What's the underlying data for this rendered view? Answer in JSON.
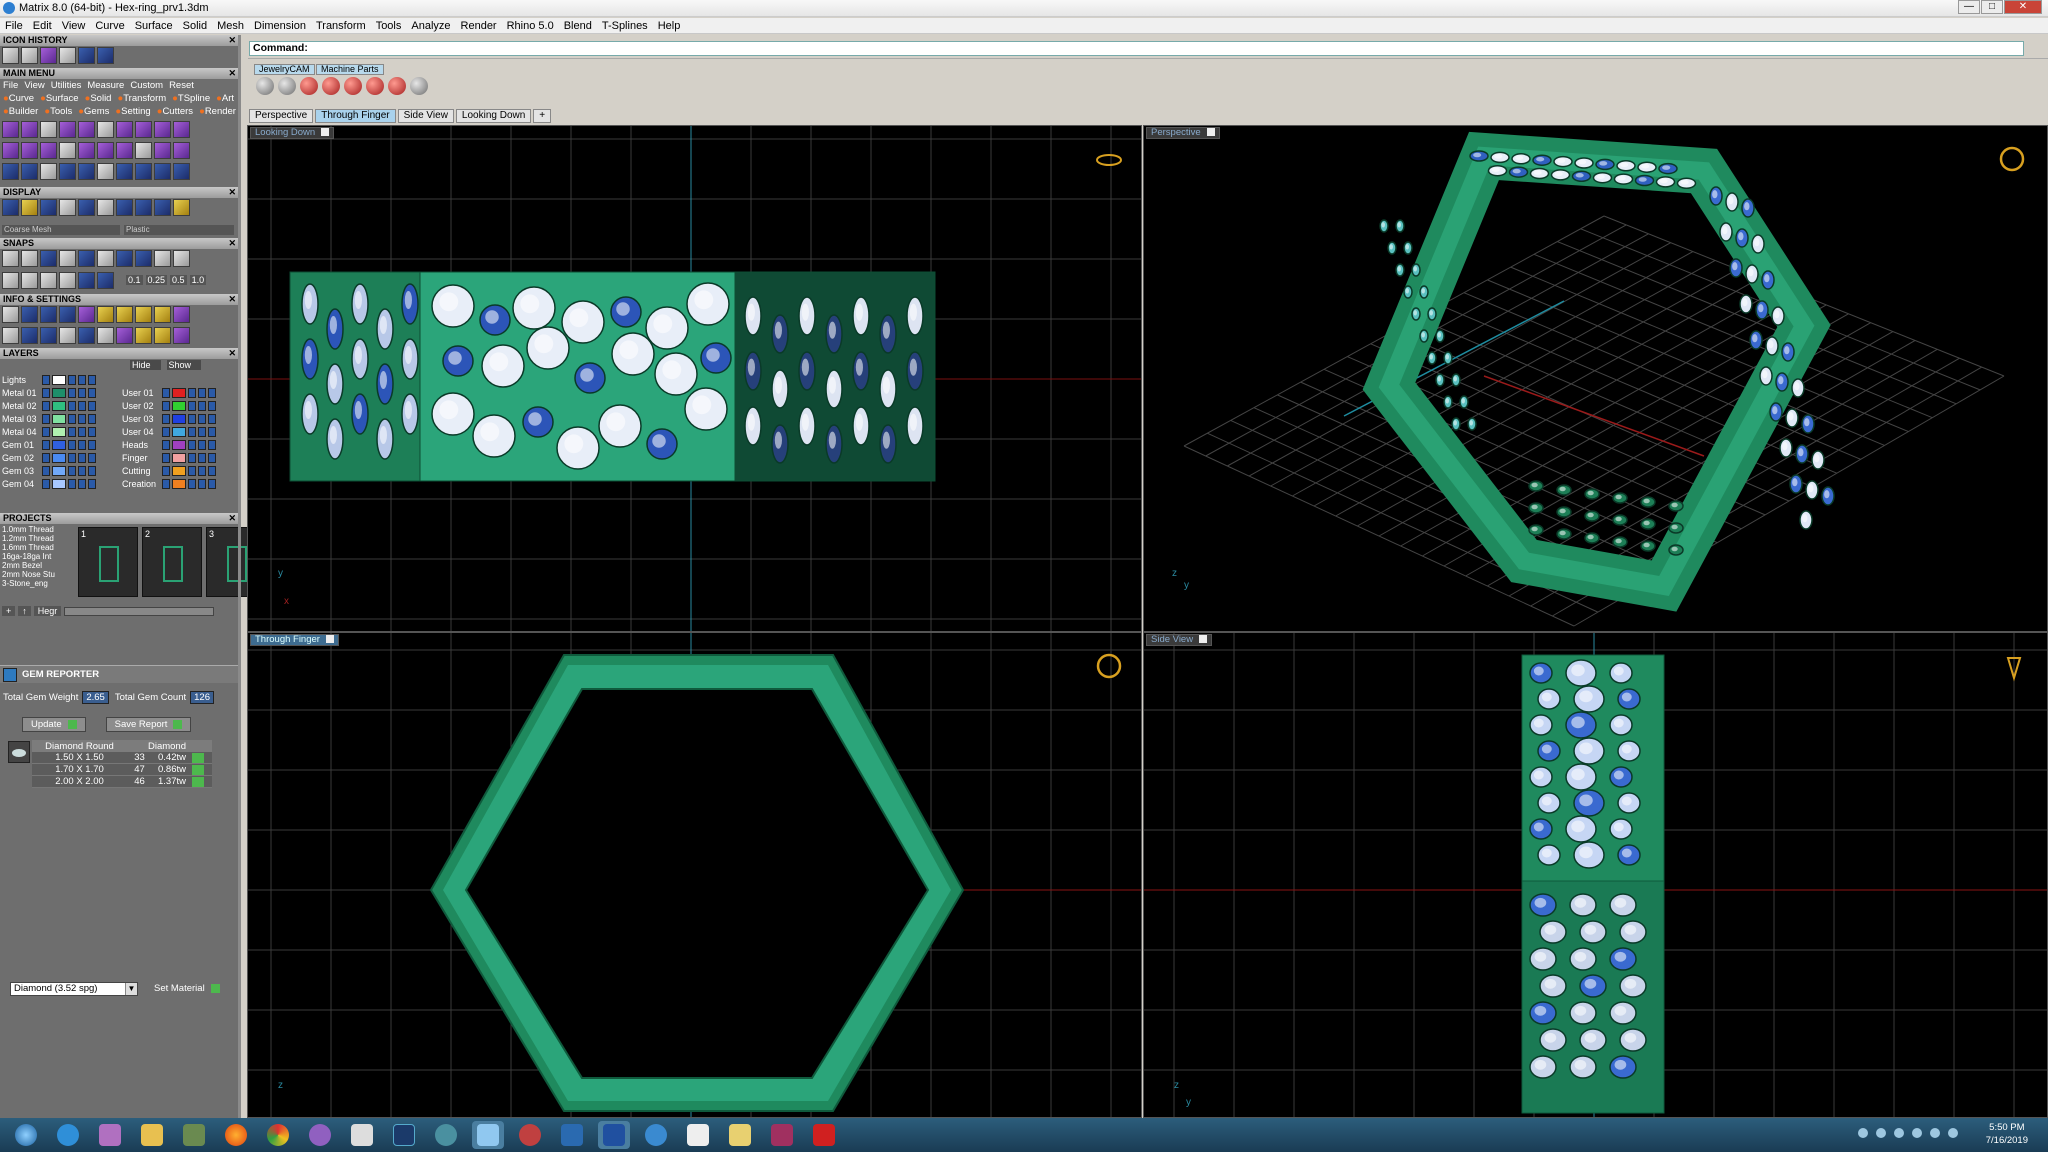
{
  "window": {
    "title": "Matrix 8.0 (64-bit) - Hex-ring_prv1.3dm",
    "min": "—",
    "max": "□",
    "close": "✕"
  },
  "menubar": [
    "File",
    "Edit",
    "View",
    "Curve",
    "Surface",
    "Solid",
    "Mesh",
    "Dimension",
    "Transform",
    "Tools",
    "Analyze",
    "Render",
    "Rhino 5.0",
    "Blend",
    "T-Splines",
    "Help"
  ],
  "left": {
    "icon_history": "ICON HISTORY",
    "main_menu": "MAIN MENU",
    "mm_top": [
      "File",
      "View",
      "Utilities",
      "Measure",
      "Custom",
      "Reset"
    ],
    "mm_row1": [
      "Curve",
      "Surface",
      "Solid",
      "Transform",
      "TSpline",
      "Art"
    ],
    "mm_row2": [
      "Builder",
      "Tools",
      "Gems",
      "Setting",
      "Cutters",
      "Render"
    ],
    "display": "DISPLAY",
    "display_mesh": "Coarse Mesh",
    "display_mat": "Plastic",
    "snaps": "SNAPS",
    "snap_vals": [
      "0.1",
      "0.25",
      "0.5",
      "1.0"
    ],
    "info": "INFO & SETTINGS",
    "layers": "LAYERS",
    "layer_hide": "Hide",
    "layer_show": "Show",
    "layers_left": [
      {
        "name": "Lights",
        "color": "#ffffff"
      },
      {
        "name": "Metal 01",
        "color": "#1e8f6a"
      },
      {
        "name": "Metal 02",
        "color": "#2fbf80"
      },
      {
        "name": "Metal 03",
        "color": "#7fe0a0"
      },
      {
        "name": "Metal 04",
        "color": "#b0f0b0"
      },
      {
        "name": "Gem 01",
        "color": "#3060e0"
      },
      {
        "name": "Gem 02",
        "color": "#4a8af0"
      },
      {
        "name": "Gem 03",
        "color": "#70a8f8"
      },
      {
        "name": "Gem 04",
        "color": "#a8c8ff"
      }
    ],
    "layers_right": [
      {
        "name": "User 01",
        "color": "#e02020"
      },
      {
        "name": "User 02",
        "color": "#30d030"
      },
      {
        "name": "User 03",
        "color": "#2040e0"
      },
      {
        "name": "User 04",
        "color": "#40a8e0"
      },
      {
        "name": "Heads",
        "color": "#a040c0"
      },
      {
        "name": "Finger",
        "color": "#f0a0a0"
      },
      {
        "name": "Cutting",
        "color": "#f0a020"
      },
      {
        "name": "Creation",
        "color": "#f08020"
      }
    ],
    "projects": "PROJECTS",
    "project_items": [
      "1.0mm Thread",
      "1.2mm Thread",
      "1.6mm Thread",
      "16ga-18ga Int",
      "2mm Bezel",
      "2mm Nose Stu",
      "3-Stone_eng"
    ],
    "project_nums": [
      "1",
      "2",
      "3"
    ],
    "project_btn": "Hegr"
  },
  "gem": {
    "title": "GEM REPORTER",
    "tgw_label": "Total Gem Weight",
    "tgw": "2.65",
    "tgc_label": "Total Gem Count",
    "tgc": "126",
    "update": "Update",
    "save": "Save Report",
    "col1": "Diamond Round",
    "col2": "Diamond",
    "rows": [
      {
        "size": "1.50 X 1.50",
        "count": "33",
        "wt": "0.42tw"
      },
      {
        "size": "1.70 X 1.70",
        "count": "47",
        "wt": "0.86tw"
      },
      {
        "size": "2.00 X 2.00",
        "count": "46",
        "wt": "1.37tw"
      }
    ],
    "material": "Diamond    (3.52 spg)",
    "set_material": "Set Material"
  },
  "command_label": "Command:",
  "toolbar_tabs": [
    "JewelryCAM",
    "Machine Parts"
  ],
  "viewport_tabs": [
    "Perspective",
    "Through Finger",
    "Side View",
    "Looking Down"
  ],
  "viewport_tab_add": "+",
  "viewports": {
    "tl": "Looking Down",
    "tr": "Perspective",
    "bl": "Through Finger",
    "br": "Side View"
  },
  "axis": {
    "x": "x",
    "y": "y",
    "z": "z"
  },
  "clock": {
    "time": "5:50 PM",
    "date": "7/16/2019"
  },
  "colors": {
    "band": "#218a62",
    "band_light": "#2aa274",
    "gem_white": "#e8eef8",
    "gem_blue": "#2c55b8",
    "grid": "#3a3a3a",
    "accent": "#4ac4e8"
  }
}
